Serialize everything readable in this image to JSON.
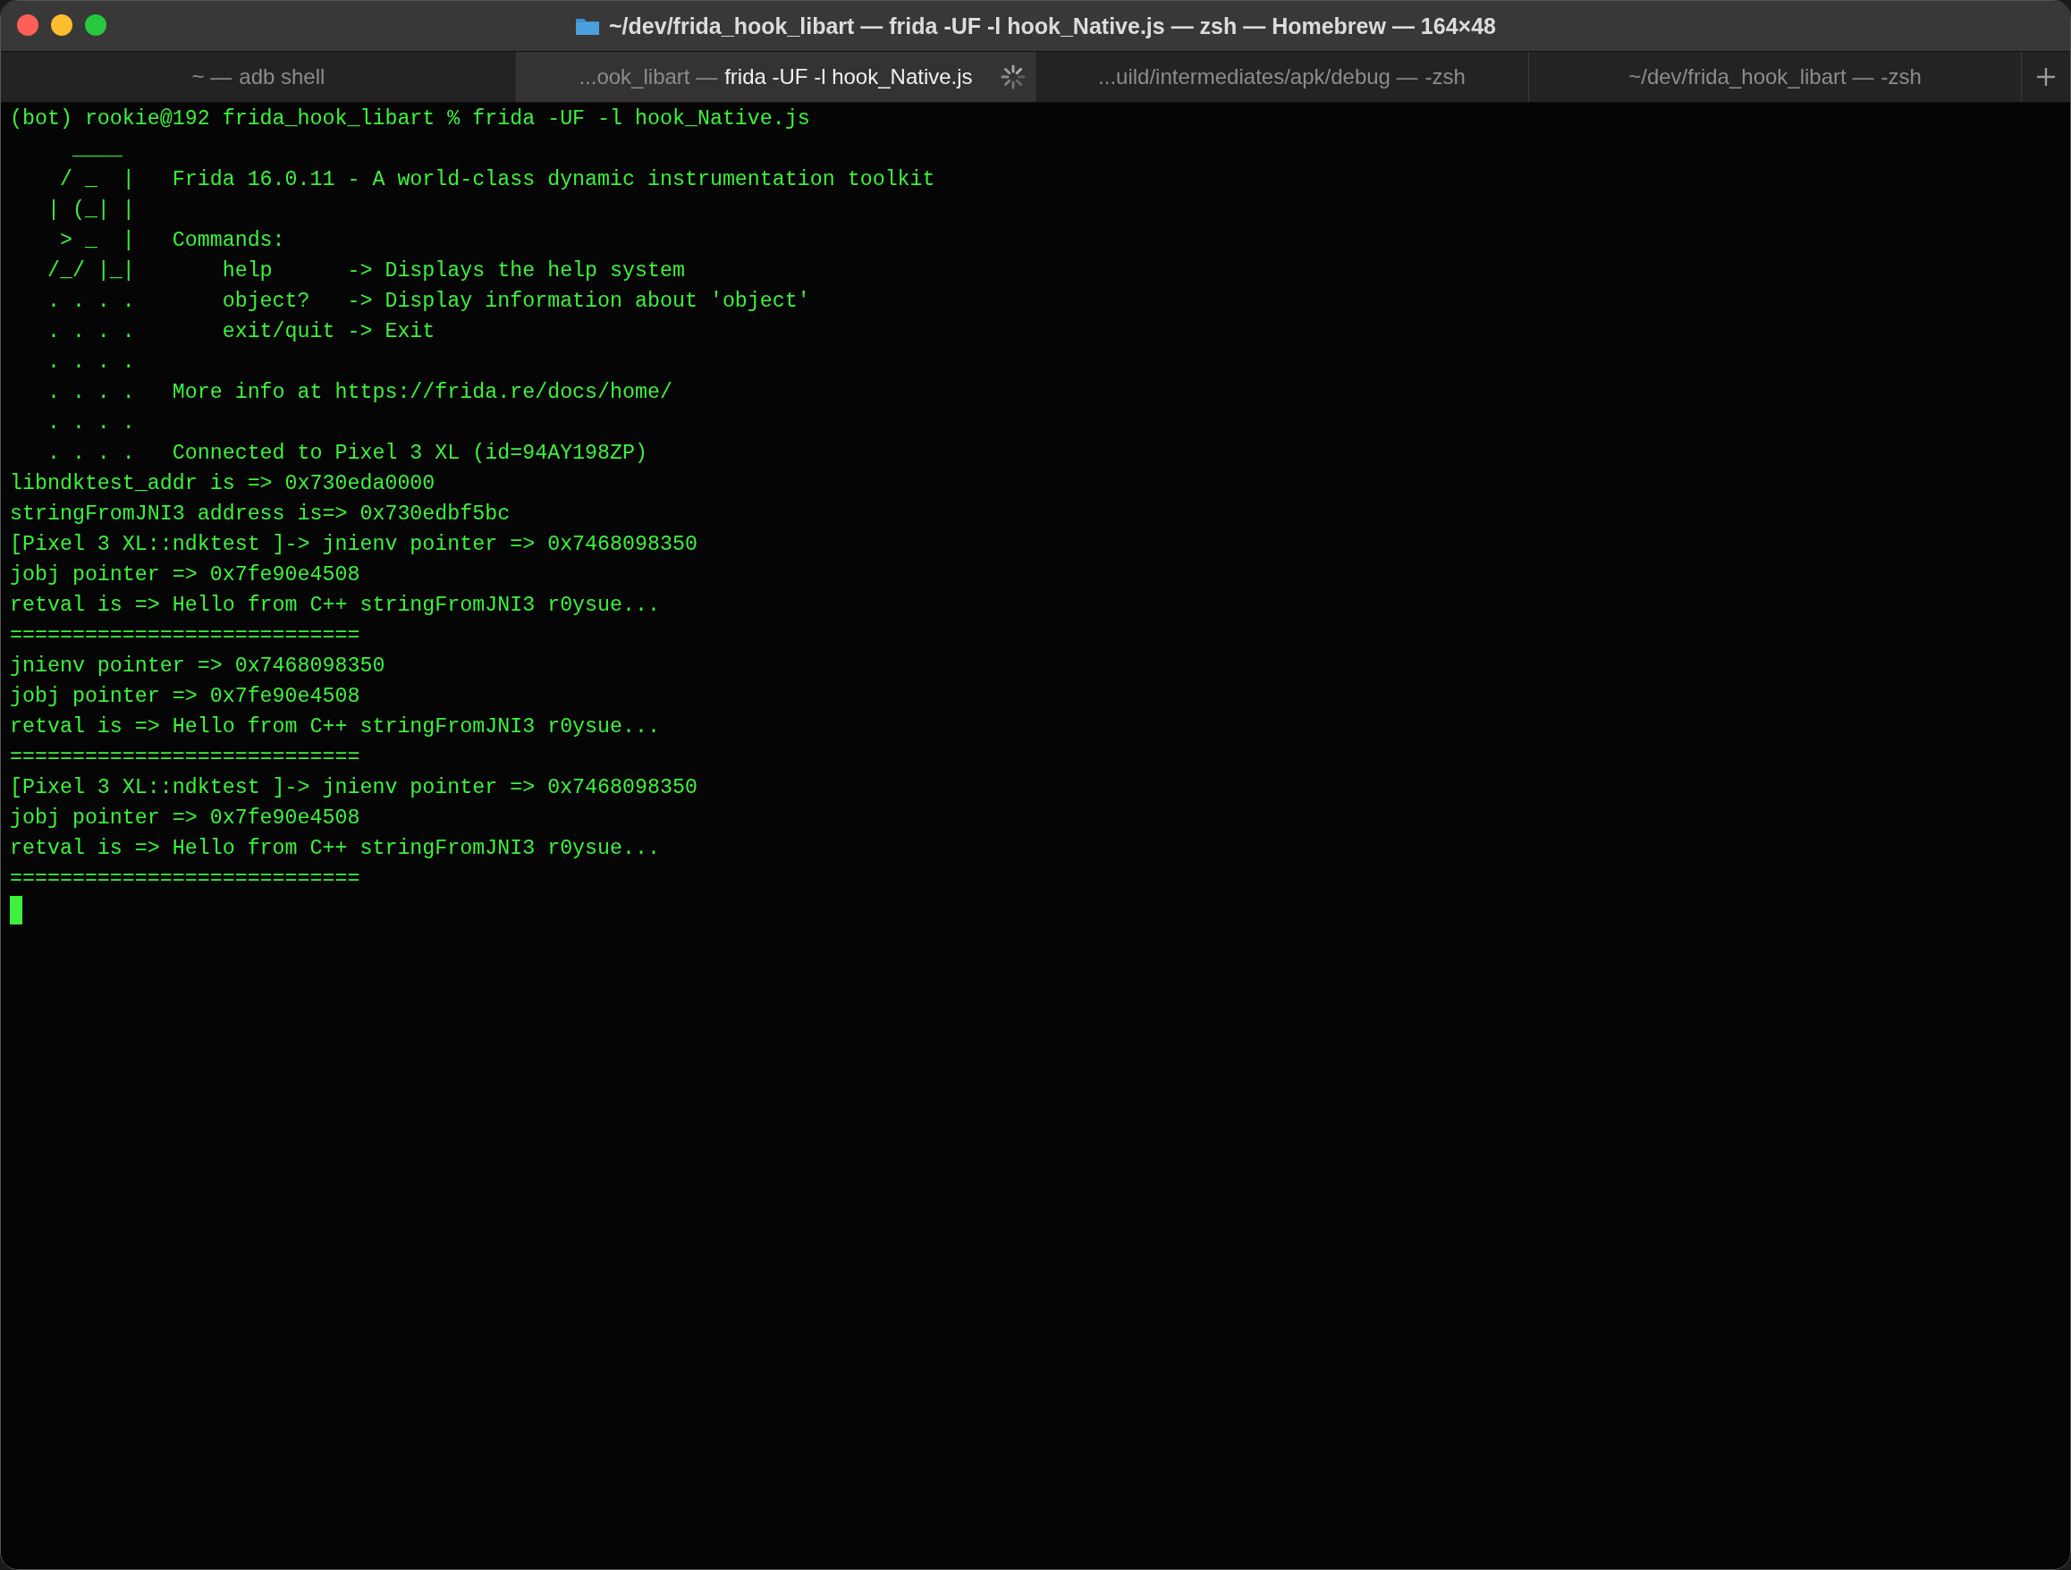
{
  "window": {
    "title": "~/dev/frida_hook_libart — frida -UF -l hook_Native.js — zsh — Homebrew — 164×48"
  },
  "tabs": [
    {
      "directory": "~ —",
      "command": "adb shell",
      "selected": false,
      "busy": false
    },
    {
      "directory": "...ook_libart —",
      "command": "frida -UF -l hook_Native.js",
      "selected": true,
      "busy": true
    },
    {
      "directory": "...uild/intermediates/apk/debug —",
      "command": "-zsh",
      "selected": false,
      "busy": false
    },
    {
      "directory": "~/dev/frida_hook_libart —",
      "command": "-zsh",
      "selected": false,
      "busy": false
    }
  ],
  "terminal": {
    "lines": [
      "(bot) rookie@192 frida_hook_libart % frida -UF -l hook_Native.js",
      "     ____",
      "    / _  |   Frida 16.0.11 - A world-class dynamic instrumentation toolkit",
      "   | (_| |",
      "    > _  |   Commands:",
      "   /_/ |_|       help      -> Displays the help system",
      "   . . . .       object?   -> Display information about 'object'",
      "   . . . .       exit/quit -> Exit",
      "   . . . .",
      "   . . . .   More info at https://frida.re/docs/home/",
      "   . . . .",
      "   . . . .   Connected to Pixel 3 XL (id=94AY198ZP)",
      "libndktest_addr is => 0x730eda0000",
      "stringFromJNI3 address is=> 0x730edbf5bc",
      "[Pixel 3 XL::ndktest ]-> jnienv pointer => 0x7468098350",
      "jobj pointer => 0x7fe90e4508",
      "retval is => Hello from C++ stringFromJNI3 r0ysue...",
      "============================",
      "jnienv pointer => 0x7468098350",
      "jobj pointer => 0x7fe90e4508",
      "retval is => Hello from C++ stringFromJNI3 r0ysue...",
      "============================",
      "[Pixel 3 XL::ndktest ]-> jnienv pointer => 0x7468098350",
      "jobj pointer => 0x7fe90e4508",
      "retval is => Hello from C++ stringFromJNI3 r0ysue...",
      "============================"
    ],
    "cursor": true
  }
}
